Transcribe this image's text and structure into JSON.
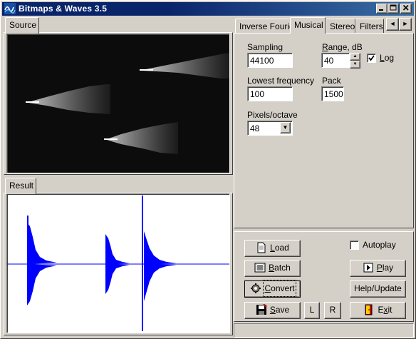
{
  "window": {
    "title": "Bitmaps & Waves 3.5"
  },
  "icons": {
    "app": "waves-app-icon",
    "minimize": "minimize-icon",
    "maximize": "maximize-icon",
    "close": "close-icon"
  },
  "left": {
    "source_tab": "Source",
    "result_tab": "Result"
  },
  "right": {
    "tabs": [
      {
        "label": "Inverse Fourie",
        "active": false
      },
      {
        "label": "Musical",
        "active": true
      },
      {
        "label": "Stereo",
        "active": false
      },
      {
        "label": "Filters",
        "active": false
      }
    ],
    "scroll_left": "◄",
    "scroll_right": "►",
    "musical": {
      "sampling_label": "Sampling",
      "sampling_value": "44100",
      "range_label": "Range, dB",
      "range_value": "40",
      "log_label": "Log",
      "log_checked": true,
      "lowest_label": "Lowest frequency",
      "lowest_value": "100",
      "pack_label": "Pack",
      "pack_value": "1500",
      "pixels_label": "Pixels/octave",
      "pixels_value": "48"
    }
  },
  "controls": {
    "load": "Load",
    "batch": "Batch",
    "convert": "Convert",
    "save": "Save",
    "left_channel": "L",
    "right_channel": "R",
    "autoplay_label": "Autoplay",
    "autoplay_checked": false,
    "play": "Play",
    "help_update": "Help/Update",
    "exit": "Exit"
  },
  "colors": {
    "titlebar": "#0a246a",
    "waveform": "#0000ff",
    "source_bg": "#0c0c0c"
  }
}
